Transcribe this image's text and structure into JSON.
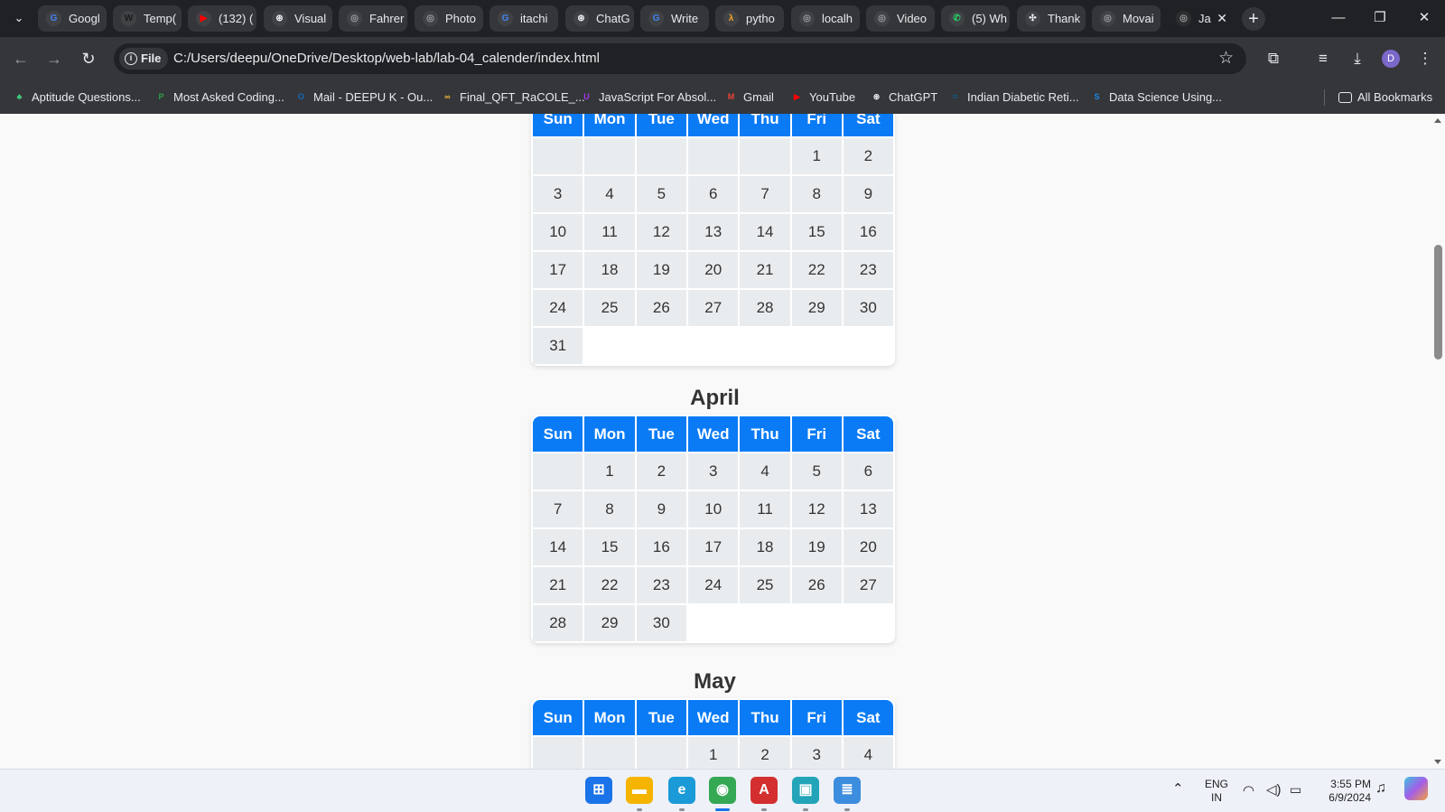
{
  "browser": {
    "tabs": [
      {
        "title": "Googl",
        "icon": "google-icon",
        "color": "#4285f4",
        "glyph": "G"
      },
      {
        "title": "Temp(",
        "icon": "wix-icon",
        "color": "#1a1a1a",
        "glyph": "W"
      },
      {
        "title": "(132) (",
        "icon": "youtube-icon",
        "color": "#ff0000",
        "glyph": "▶"
      },
      {
        "title": "Visual",
        "icon": "chatgpt-icon",
        "color": "#e8eaed",
        "glyph": "⊛"
      },
      {
        "title": "Fahrer",
        "icon": "globe-icon",
        "color": "#9aa0a6",
        "glyph": "◎"
      },
      {
        "title": "Photo",
        "icon": "globe-icon",
        "color": "#9aa0a6",
        "glyph": "◎"
      },
      {
        "title": "itachi",
        "icon": "google-icon",
        "color": "#4285f4",
        "glyph": "G"
      },
      {
        "title": "ChatG",
        "icon": "chatgpt-icon",
        "color": "#e8eaed",
        "glyph": "⊛"
      },
      {
        "title": "Write",
        "icon": "google-icon",
        "color": "#4285f4",
        "glyph": "G"
      },
      {
        "title": "pytho",
        "icon": "python-icon",
        "color": "#f5a623",
        "glyph": "λ"
      },
      {
        "title": "localh",
        "icon": "globe-icon",
        "color": "#9aa0a6",
        "glyph": "◎"
      },
      {
        "title": "Video",
        "icon": "globe-icon",
        "color": "#9aa0a6",
        "glyph": "◎"
      },
      {
        "title": "(5) Wh",
        "icon": "whatsapp-icon",
        "color": "#25d366",
        "glyph": "✆"
      },
      {
        "title": "Thank",
        "icon": "dots-icon",
        "color": "#e8eaed",
        "glyph": "✣"
      },
      {
        "title": "Movai",
        "icon": "globe-icon",
        "color": "#9aa0a6",
        "glyph": "◎"
      },
      {
        "title": "Ja",
        "icon": "globe-icon",
        "color": "#9aa0a6",
        "glyph": "◎"
      }
    ],
    "scheme_label": "File",
    "url": "C:/Users/deepu/OneDrive/Desktop/web-lab/lab-04_calender/index.html",
    "avatar_letter": "D",
    "bookmarks": [
      {
        "label": "Aptitude Questions...",
        "icon": "tree-icon",
        "color": "#3ddc84",
        "glyph": "♣"
      },
      {
        "label": "Most Asked Coding...",
        "icon": "leaf-icon",
        "color": "#2e9e44",
        "glyph": "P"
      },
      {
        "label": "Mail - DEEPU K - Ou...",
        "icon": "outlook-icon",
        "color": "#0f6cbd",
        "glyph": "O"
      },
      {
        "label": "Final_QFT_RaCOLE_...",
        "icon": "infinity-icon",
        "color": "#f6b73c",
        "glyph": "∞"
      },
      {
        "label": "JavaScript For Absol...",
        "icon": "udemy-icon",
        "color": "#a435f0",
        "glyph": "U"
      },
      {
        "label": "Gmail",
        "icon": "gmail-icon",
        "color": "#ea4335",
        "glyph": "M"
      },
      {
        "label": "YouTube",
        "icon": "youtube-icon",
        "color": "#ff0000",
        "glyph": "▶"
      },
      {
        "label": "ChatGPT",
        "icon": "chatgpt-icon",
        "color": "#e8eaed",
        "glyph": "⊛"
      },
      {
        "label": "Indian Diabetic Reti...",
        "icon": "ieee-icon",
        "color": "#00629b",
        "glyph": "≡"
      },
      {
        "label": "Data Science Using...",
        "icon": "s-icon",
        "color": "#1e88e5",
        "glyph": "S"
      }
    ],
    "all_bookmarks_label": "All Bookmarks"
  },
  "calendar": {
    "weekdays": [
      "Sun",
      "Mon",
      "Tue",
      "Wed",
      "Thu",
      "Fri",
      "Sat"
    ],
    "months": [
      {
        "title": "",
        "weeks": [
          [
            "",
            "",
            "",
            "",
            "",
            "1",
            "2"
          ],
          [
            "3",
            "4",
            "5",
            "6",
            "7",
            "8",
            "9"
          ],
          [
            "10",
            "11",
            "12",
            "13",
            "14",
            "15",
            "16"
          ],
          [
            "17",
            "18",
            "19",
            "20",
            "21",
            "22",
            "23"
          ],
          [
            "24",
            "25",
            "26",
            "27",
            "28",
            "29",
            "30"
          ],
          [
            "31",
            null,
            null,
            null,
            null,
            null,
            null
          ]
        ]
      },
      {
        "title": "April",
        "weeks": [
          [
            "",
            "1",
            "2",
            "3",
            "4",
            "5",
            "6"
          ],
          [
            "7",
            "8",
            "9",
            "10",
            "11",
            "12",
            "13"
          ],
          [
            "14",
            "15",
            "16",
            "17",
            "18",
            "19",
            "20"
          ],
          [
            "21",
            "22",
            "23",
            "24",
            "25",
            "26",
            "27"
          ],
          [
            "28",
            "29",
            "30",
            null,
            null,
            null,
            null
          ]
        ]
      },
      {
        "title": "May",
        "weeks": [
          [
            "",
            "",
            "",
            "1",
            "2",
            "3",
            "4"
          ]
        ]
      }
    ]
  },
  "taskbar": {
    "apps": [
      {
        "name": "start-icon",
        "color": "#1a73e8",
        "glyph": "⊞"
      },
      {
        "name": "file-explorer-icon",
        "color": "#f4b400",
        "glyph": "▬"
      },
      {
        "name": "edge-icon",
        "color": "#1a9ad6",
        "glyph": "e"
      },
      {
        "name": "chrome-icon",
        "color": "#34a853",
        "glyph": "◉"
      },
      {
        "name": "acrobat-icon",
        "color": "#d32f2f",
        "glyph": "A"
      },
      {
        "name": "terminal-icon",
        "color": "#23a4b8",
        "glyph": "▣"
      },
      {
        "name": "notepad-icon",
        "color": "#3c8dde",
        "glyph": "≣"
      }
    ],
    "lang_top": "ENG",
    "lang_bottom": "IN",
    "time": "3:55 PM",
    "date": "6/9/2024"
  }
}
